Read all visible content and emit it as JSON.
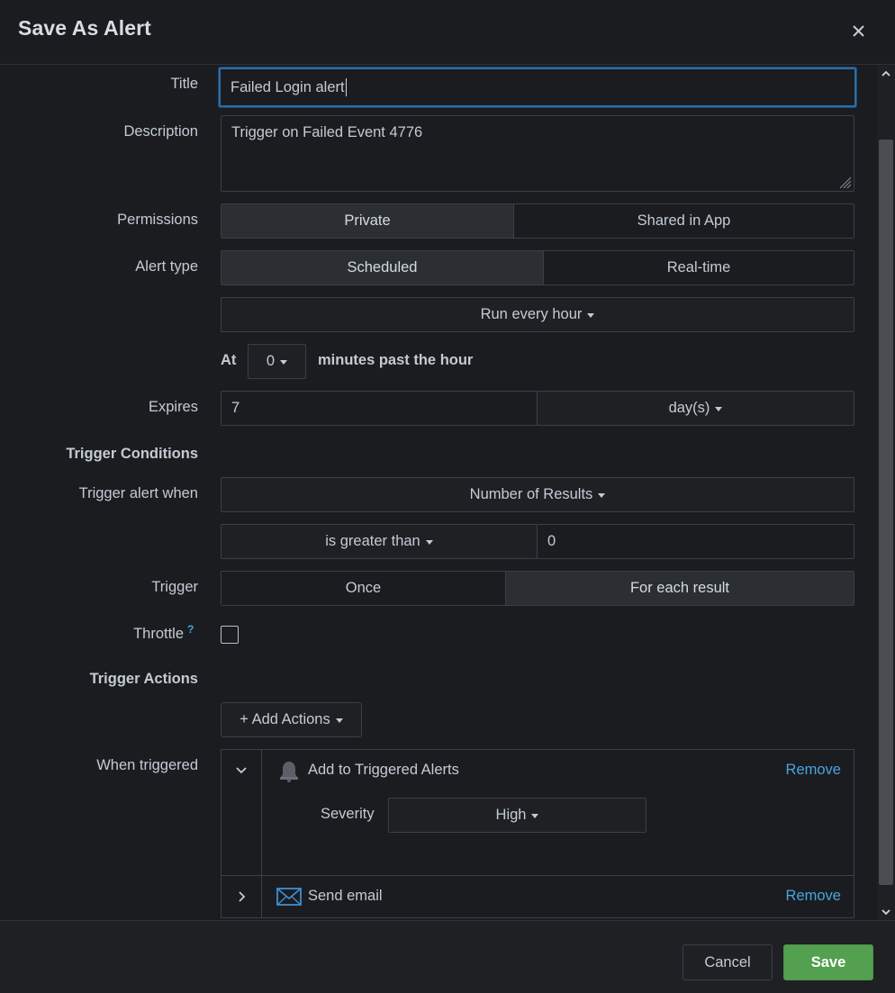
{
  "modal": {
    "title": "Save As Alert"
  },
  "form": {
    "title_label": "Title",
    "title_value": "Failed Login alert",
    "description_label": "Description",
    "description_value": "Trigger on Failed Event 4776",
    "permissions_label": "Permissions",
    "permissions_options": [
      "Private",
      "Shared in App"
    ],
    "permissions_selected": "Private",
    "alert_type_label": "Alert type",
    "alert_type_options": [
      "Scheduled",
      "Real-time"
    ],
    "alert_type_selected": "Scheduled",
    "schedule_value": "Run every hour",
    "at_label": "At",
    "minutes_value": "0",
    "minutes_suffix": "minutes past the hour",
    "expires_label": "Expires",
    "expires_value": "7",
    "expires_unit": "day(s)"
  },
  "trigger_conditions": {
    "heading": "Trigger Conditions",
    "trigger_when_label": "Trigger alert when",
    "trigger_when_value": "Number of Results",
    "comparison_value": "is greater than",
    "threshold_value": "0",
    "trigger_label": "Trigger",
    "trigger_options": [
      "Once",
      "For each result"
    ],
    "trigger_selected": "For each result",
    "throttle_label": "Throttle",
    "throttle_help": "?",
    "throttle_checked": false
  },
  "trigger_actions": {
    "heading": "Trigger Actions",
    "add_actions_label": "+ Add Actions",
    "when_triggered_label": "When triggered",
    "actions": [
      {
        "name": "Add to Triggered Alerts",
        "remove_label": "Remove",
        "expanded": true,
        "severity_label": "Severity",
        "severity_value": "High",
        "icon": "bell-icon"
      },
      {
        "name": "Send email",
        "remove_label": "Remove",
        "expanded": false,
        "icon": "envelope-icon"
      }
    ]
  },
  "footer": {
    "cancel_label": "Cancel",
    "save_label": "Save"
  },
  "colors": {
    "background": "#1a1c20",
    "border": "#3b3f46",
    "focus": "#2e6da6",
    "link": "#4aa3df",
    "primary": "#53a050"
  }
}
